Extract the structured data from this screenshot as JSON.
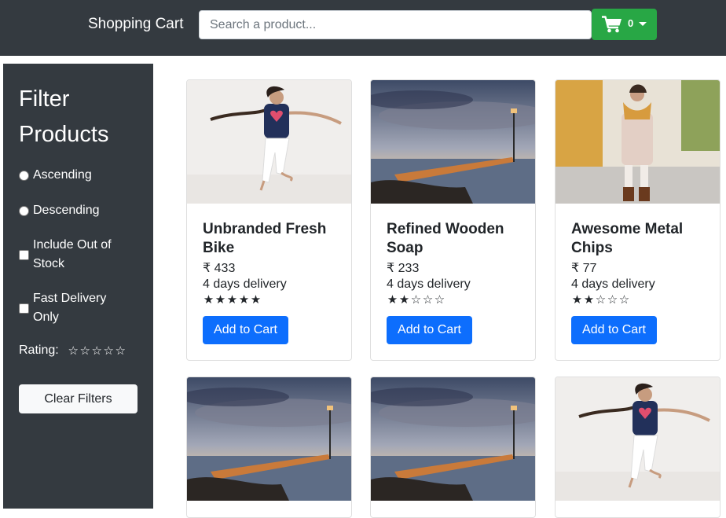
{
  "header": {
    "brand": "Shopping Cart",
    "search_placeholder": "Search a product...",
    "cart_count": "0",
    "cart_icon": "shopping-cart-icon",
    "colors": {
      "navbar": "#343a40",
      "cart_button": "#28a745"
    }
  },
  "sidebar": {
    "title": "Filter Products",
    "sort_options": [
      {
        "label": "Ascending",
        "checked": false
      },
      {
        "label": "Descending",
        "checked": false
      }
    ],
    "checkboxes": [
      {
        "label": "Include Out of Stock",
        "checked": false
      },
      {
        "label": "Fast Delivery Only",
        "checked": false
      }
    ],
    "rating_label": "Rating:",
    "rating_value": 0,
    "rating_max": 5,
    "clear_label": "Clear Filters"
  },
  "currency_symbol": "₹",
  "products": [
    {
      "name": "Unbranded Fresh Bike",
      "price": "433",
      "delivery": "4 days delivery",
      "rating": 5,
      "image": "woman-jumping-photo",
      "button": "Add to Cart"
    },
    {
      "name": "Refined Wooden Soap",
      "price": "233",
      "delivery": "4 days delivery",
      "rating": 2,
      "image": "pier-sunset-photo",
      "button": "Add to Cart"
    },
    {
      "name": "Awesome Metal Chips",
      "price": "77",
      "delivery": "4 days delivery",
      "rating": 2,
      "image": "woman-autumn-coat-photo",
      "button": "Add to Cart"
    },
    {
      "image": "pier-sunset-photo"
    },
    {
      "image": "pier-sunset-photo"
    },
    {
      "image": "woman-jumping-photo"
    }
  ],
  "colors": {
    "primary_button": "#0d6efd",
    "sidebar": "#343a40"
  }
}
